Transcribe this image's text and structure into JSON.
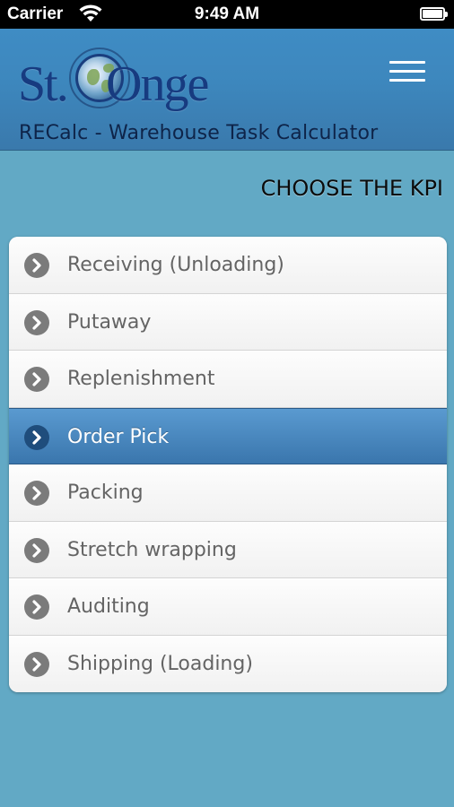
{
  "status_bar": {
    "carrier": "Carrier",
    "time": "9:49 AM",
    "wifi_icon": "wifi-icon",
    "battery_icon": "battery-icon"
  },
  "header": {
    "logo_text_st": "St.",
    "logo_text_onge": "Onge",
    "logo_icon": "globe-logo",
    "menu_icon": "hamburger-menu-icon",
    "title": "RECalc - Warehouse Task Calculator"
  },
  "main": {
    "heading": "CHOOSE THE KPI",
    "kpis": [
      {
        "label": "Receiving (Unloading)",
        "active": false
      },
      {
        "label": "Putaway",
        "active": false
      },
      {
        "label": "Replenishment",
        "active": false
      },
      {
        "label": "Order Pick",
        "active": true
      },
      {
        "label": "Packing",
        "active": false
      },
      {
        "label": "Stretch wrapping",
        "active": false
      },
      {
        "label": "Auditing",
        "active": false
      },
      {
        "label": "Shipping (Loading)",
        "active": false
      }
    ],
    "item_icon": "chevron-right-circle-icon"
  },
  "colors": {
    "background": "#62a9c5",
    "header": "#3d87bd",
    "active_item": "#4a88c0",
    "title_text": "#0e2449"
  }
}
